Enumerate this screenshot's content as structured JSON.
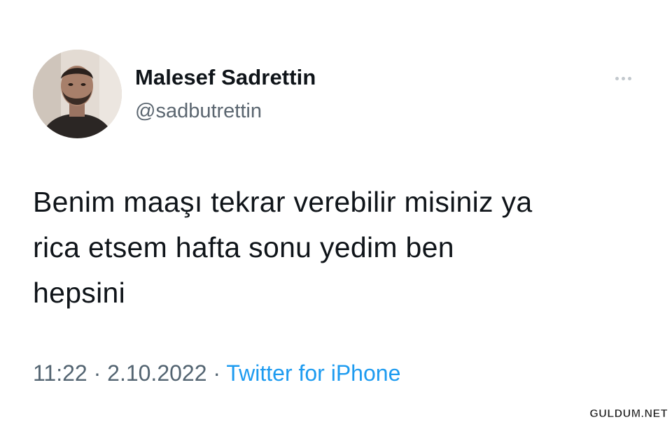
{
  "tweet": {
    "author": {
      "display_name": "Malesef Sadrettin",
      "handle": "@sadbutrettin"
    },
    "text_lines": [
      "Benim maaşı tekrar verebilir misiniz ya",
      "rica etsem hafta sonu yedim ben",
      "hepsini"
    ],
    "time": "11:22",
    "separator": "·",
    "date": "2.10.2022",
    "source": "Twitter for iPhone",
    "more_icon": "more-dots-icon"
  },
  "watermark": {
    "text": "GULDUM.NET"
  },
  "colors": {
    "background": "#ffffff",
    "text_primary": "#0f1419",
    "text_secondary": "#536471",
    "link_blue": "#1d9bf0"
  }
}
